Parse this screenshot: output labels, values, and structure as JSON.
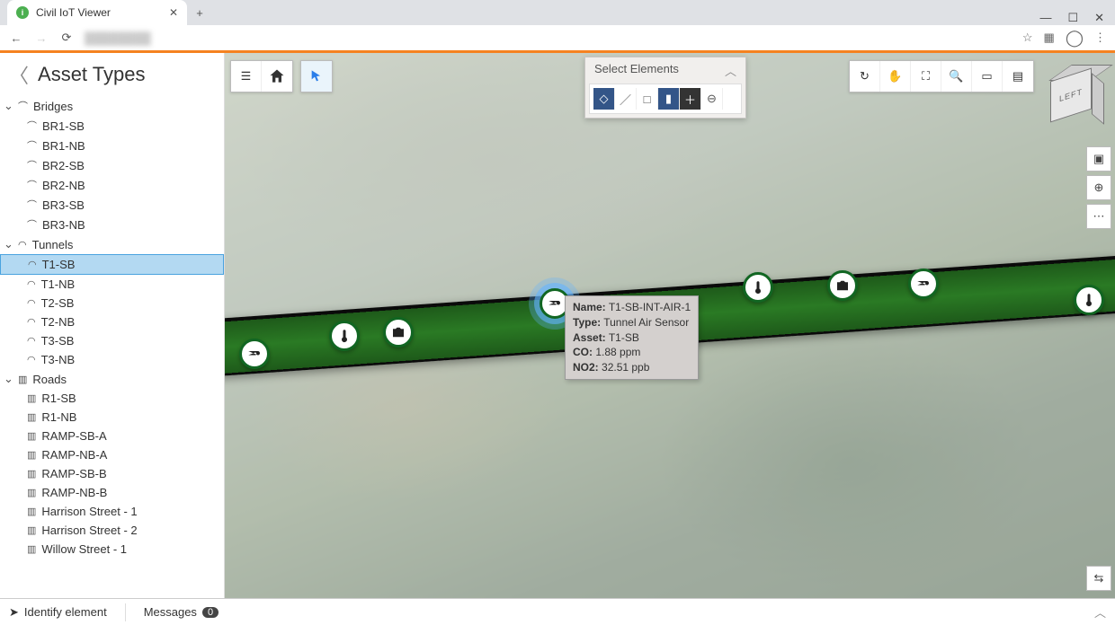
{
  "browser": {
    "tab_title": "Civil IoT Viewer",
    "window_controls": {
      "min": "—",
      "max": "☐",
      "close": "✕"
    }
  },
  "sidebar": {
    "title": "Asset Types",
    "groups": [
      {
        "label": "Bridges",
        "icon": "bridge-icon",
        "items": [
          "BR1-SB",
          "BR1-NB",
          "BR2-SB",
          "BR2-NB",
          "BR3-SB",
          "BR3-NB"
        ]
      },
      {
        "label": "Tunnels",
        "icon": "tunnel-icon",
        "items": [
          "T1-SB",
          "T1-NB",
          "T2-SB",
          "T2-NB",
          "T3-SB",
          "T3-NB"
        ],
        "selected": "T1-SB"
      },
      {
        "label": "Roads",
        "icon": "road-icon",
        "items": [
          "R1-SB",
          "R1-NB",
          "RAMP-SB-A",
          "RAMP-NB-A",
          "RAMP-SB-B",
          "RAMP-NB-B",
          "Harrison Street - 1",
          "Harrison Street - 2",
          "Willow Street - 1"
        ]
      }
    ]
  },
  "select_panel": {
    "title": "Select Elements"
  },
  "info_popup": {
    "name_label": "Name:",
    "name_value": "T1-SB-INT-AIR-1",
    "type_label": "Type:",
    "type_value": "Tunnel Air Sensor",
    "asset_label": "Asset:",
    "asset_value": "T1-SB",
    "co_label": "CO:",
    "co_value": "1.88 ppm",
    "no2_label": "NO2:",
    "no2_value": "32.51 ppb"
  },
  "nav_cube": {
    "face": "LEFT"
  },
  "status": {
    "identify": "Identify element",
    "messages": "Messages",
    "message_count": "0"
  }
}
